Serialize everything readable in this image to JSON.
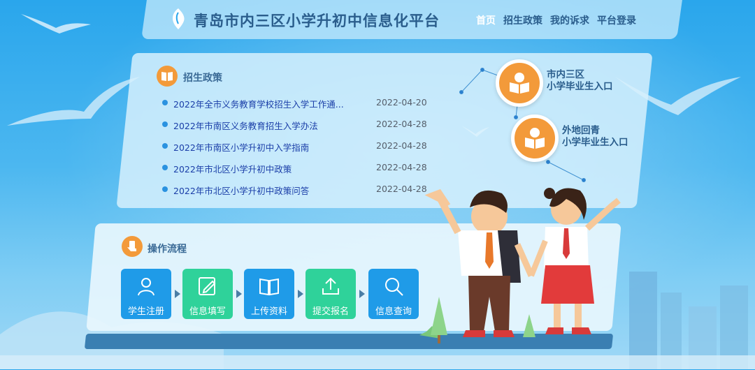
{
  "header": {
    "title": "青岛市内三区小学升初中信息化平台",
    "nav": [
      {
        "label": "首页",
        "active": true
      },
      {
        "label": "招生政策",
        "active": false
      },
      {
        "label": "我的诉求",
        "active": false
      },
      {
        "label": "平台登录",
        "active": false
      }
    ]
  },
  "policy": {
    "title": "招生政策",
    "icon": "book-icon",
    "items": [
      {
        "text": "2022年全市义务教育学校招生入学工作通...",
        "date": "2022-04-20"
      },
      {
        "text": "2022年市南区义务教育招生入学办法",
        "date": "2022-04-28"
      },
      {
        "text": "2022年市南区小学升初中入学指南",
        "date": "2022-04-28"
      },
      {
        "text": "2022年市北区小学升初中政策",
        "date": "2022-04-28"
      },
      {
        "text": "2022年市北区小学升初中政策问答",
        "date": "2022-04-28"
      }
    ]
  },
  "entrances": [
    {
      "line1": "市内三区",
      "line2": "小学毕业生入口",
      "icon": "student-reading-icon"
    },
    {
      "line1": "外地回青",
      "line2": "小学毕业生入口",
      "icon": "student-reading-icon"
    }
  ],
  "process": {
    "title": "操作流程",
    "icon": "hand-phone-icon",
    "steps": [
      {
        "label": "学生注册",
        "icon": "user-icon",
        "color": "#1f9be8"
      },
      {
        "label": "信息填写",
        "icon": "edit-icon",
        "color": "#2fd29a"
      },
      {
        "label": "上传资料",
        "icon": "book-open-icon",
        "color": "#1f9be8"
      },
      {
        "label": "提交报名",
        "icon": "upload-icon",
        "color": "#2fd29a"
      },
      {
        "label": "信息查询",
        "icon": "search-icon",
        "color": "#1f9be8"
      }
    ]
  },
  "colors": {
    "accent_orange": "#f39a3a",
    "blue": "#1f9be8",
    "green": "#2fd29a",
    "title_blue": "#2a5d8c"
  }
}
